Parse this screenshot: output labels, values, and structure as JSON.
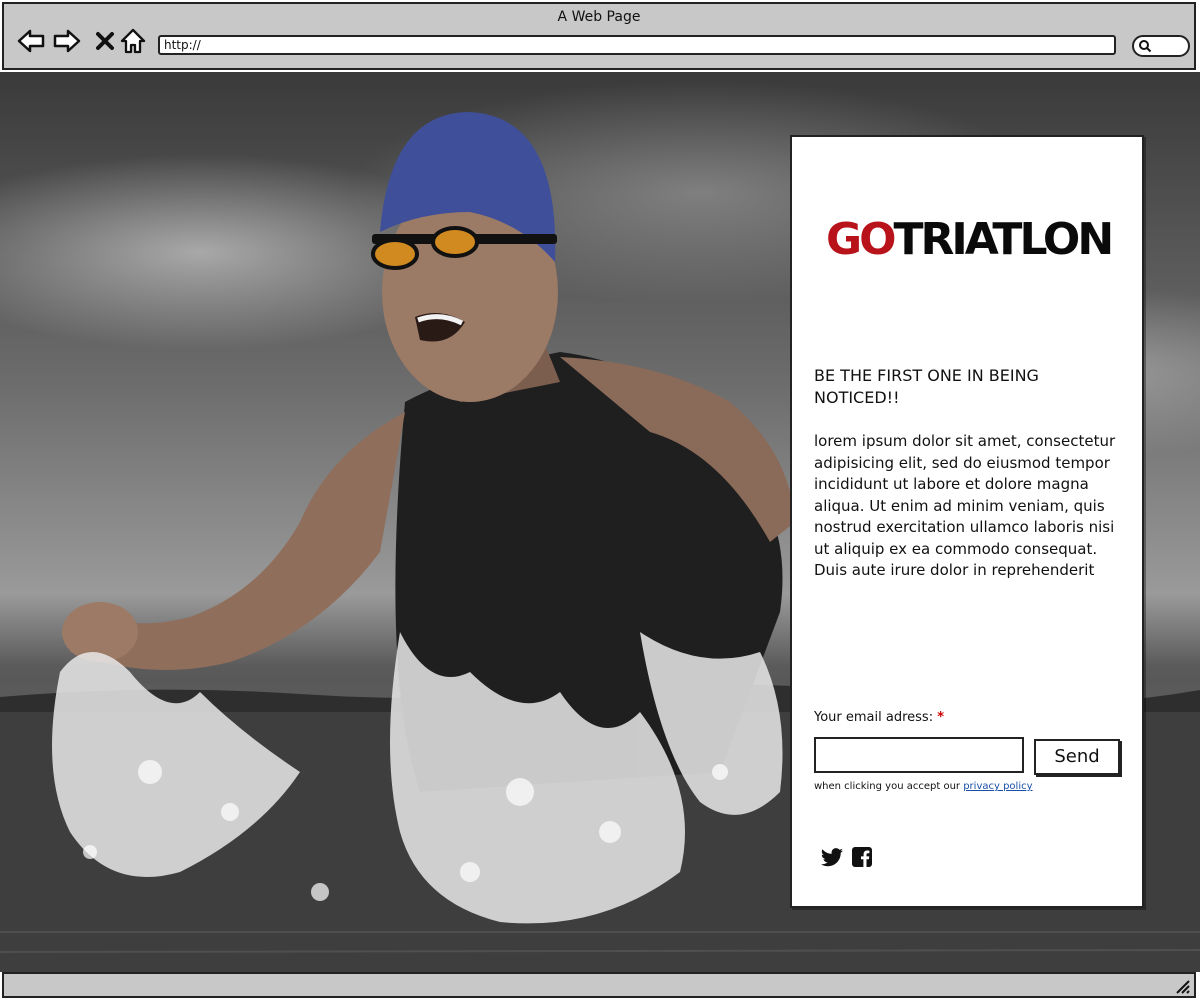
{
  "window": {
    "title": "A Web Page",
    "url": "http://"
  },
  "card": {
    "logo": {
      "go": "GO",
      "rest": "TRIATLON"
    },
    "colors": {
      "logo_accent": "#b8121b",
      "link": "#1a4fa8",
      "required": "#cc0000"
    },
    "headline": "BE THE FIRST ONE IN BEING NOTICED!!",
    "body": "lorem ipsum dolor sit amet, consectetur adipisicing elit, sed do eiusmod tempor incididunt ut labore et dolore magna aliqua. Ut enim ad minim veniam, quis nostrud exercitation ullamco laboris nisi ut aliquip ex ea commodo consequat. Duis aute irure dolor in reprehenderit",
    "form": {
      "email_label": "Your email adress:",
      "required_mark": "*",
      "email_value": "",
      "send_label": "Send",
      "legal_text": "when clicking you accept our",
      "legal_link": "privacy policy"
    },
    "social": [
      {
        "name": "twitter",
        "icon": "twitter-icon"
      },
      {
        "name": "facebook",
        "icon": "facebook-icon"
      }
    ]
  },
  "icons": {
    "back": "back-arrow-icon",
    "forward": "forward-arrow-icon",
    "stop": "close-icon",
    "home": "home-icon",
    "search": "search-icon",
    "resize": "resize-grip-icon"
  }
}
